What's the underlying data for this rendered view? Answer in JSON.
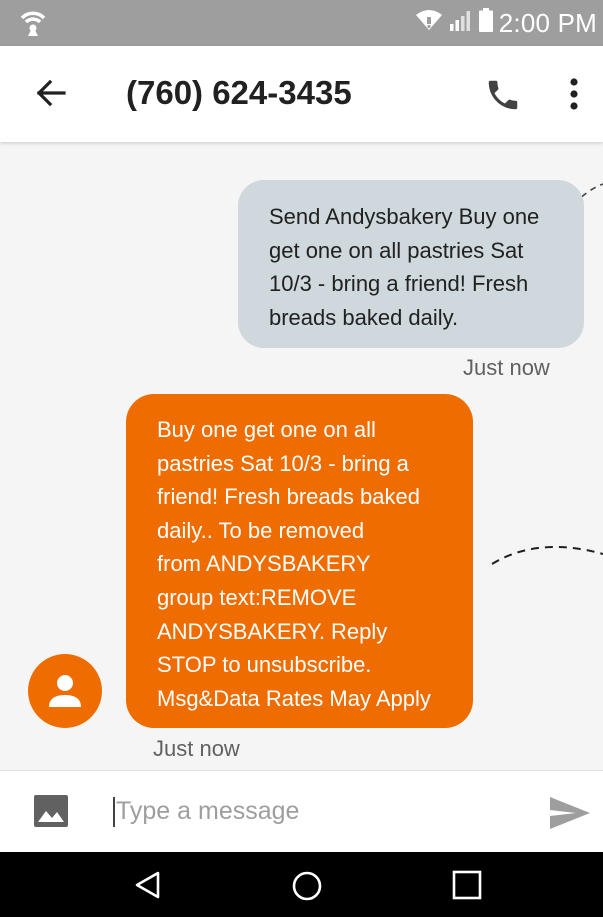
{
  "status_bar": {
    "time": "2:00 PM",
    "icons": [
      "hotspot-icon",
      "wifi-icon",
      "signal-icon",
      "battery-icon"
    ]
  },
  "app_bar": {
    "title": "(760) 624-3435",
    "icons": [
      "back-arrow-icon",
      "phone-icon",
      "more-vert-icon"
    ]
  },
  "conversation": {
    "messages": [
      {
        "direction": "outgoing",
        "lines": [
          "Send Andysbakery Buy one",
          "get one on all pastries Sat",
          "10/3 - bring a friend! Fresh",
          "breads baked daily."
        ],
        "timestamp": "Just now"
      },
      {
        "direction": "incoming",
        "lines": [
          "Buy one get one on all",
          "pastries Sat 10/3 - bring a",
          "friend! Fresh breads baked",
          "daily.. To be removed",
          "from ANDYSBAKERY",
          "group text:REMOVE",
          "ANDYSBAKERY. Reply",
          "STOP to unsubscribe.",
          "Msg&Data Rates May Apply"
        ],
        "timestamp": "Just now"
      }
    ]
  },
  "compose": {
    "placeholder": "Type a message",
    "icons": [
      "image-attach-icon",
      "send-icon"
    ]
  },
  "nav_bar": {
    "icons": [
      "back-triangle-icon",
      "home-circle-icon",
      "recents-square-icon"
    ]
  },
  "colors": {
    "status_bar": "#9e9e9e",
    "outgoing_bubble": "#cfd8dc",
    "incoming_bubble": "#ef6c00",
    "conversation_bg": "#f5f5f5",
    "nav_bar": "#000000"
  }
}
